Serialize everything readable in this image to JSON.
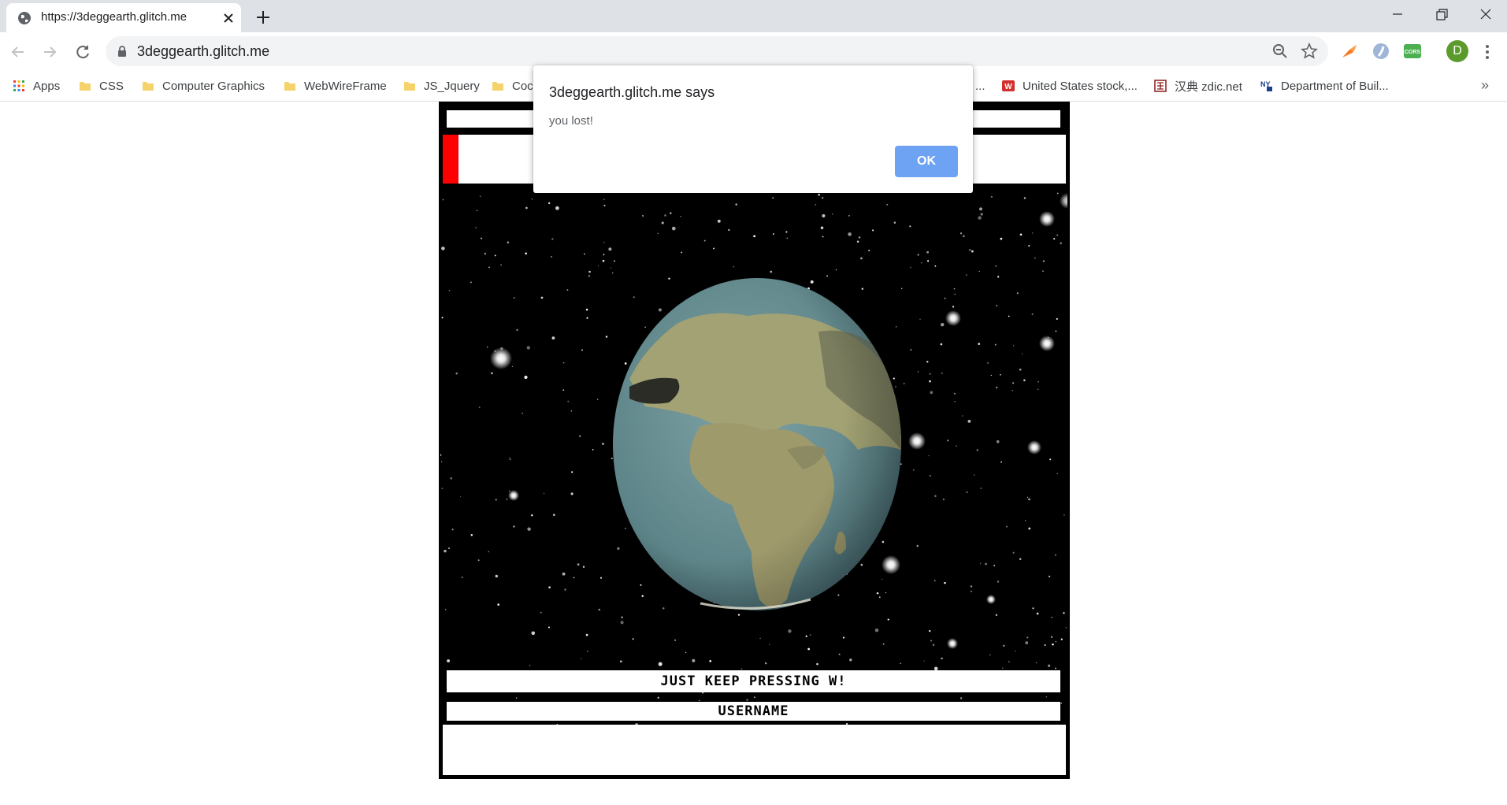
{
  "browser": {
    "tab_title": "https://3deggearth.glitch.me",
    "url": "3deggearth.glitch.me",
    "profile_initial": "D",
    "bookmarks": [
      {
        "label": "Apps",
        "icon": "apps-grid-icon"
      },
      {
        "label": "CSS",
        "icon": "folder-icon"
      },
      {
        "label": "Computer Graphics",
        "icon": "folder-icon"
      },
      {
        "label": "WebWireFrame",
        "icon": "folder-icon"
      },
      {
        "label": "JS_Jquery",
        "icon": "folder-icon"
      },
      {
        "label": "Coc",
        "icon": "folder-icon"
      },
      {
        "label": "...",
        "icon": ""
      },
      {
        "label": "United States stock,...",
        "icon": "w-logo-icon"
      },
      {
        "label": "汉典 zdic.net",
        "icon": "zdic-icon"
      },
      {
        "label": "Department of Buil...",
        "icon": "nyc-icon"
      }
    ],
    "bookmarks_overflow": "»"
  },
  "game": {
    "health_fraction": 0.025,
    "health_color": "#ff0000",
    "message": "JUST KEEP PRESSING W!",
    "username_label": "USERNAME",
    "username_value": ""
  },
  "alert": {
    "title": "3deggearth.glitch.me says",
    "message": "you lost!",
    "ok_label": "OK"
  },
  "colors": {
    "accent": "#6ea2f3",
    "tabstrip": "#dee1e6",
    "space": "#000000",
    "ocean": "#5f878f",
    "land": "#a2a274"
  }
}
